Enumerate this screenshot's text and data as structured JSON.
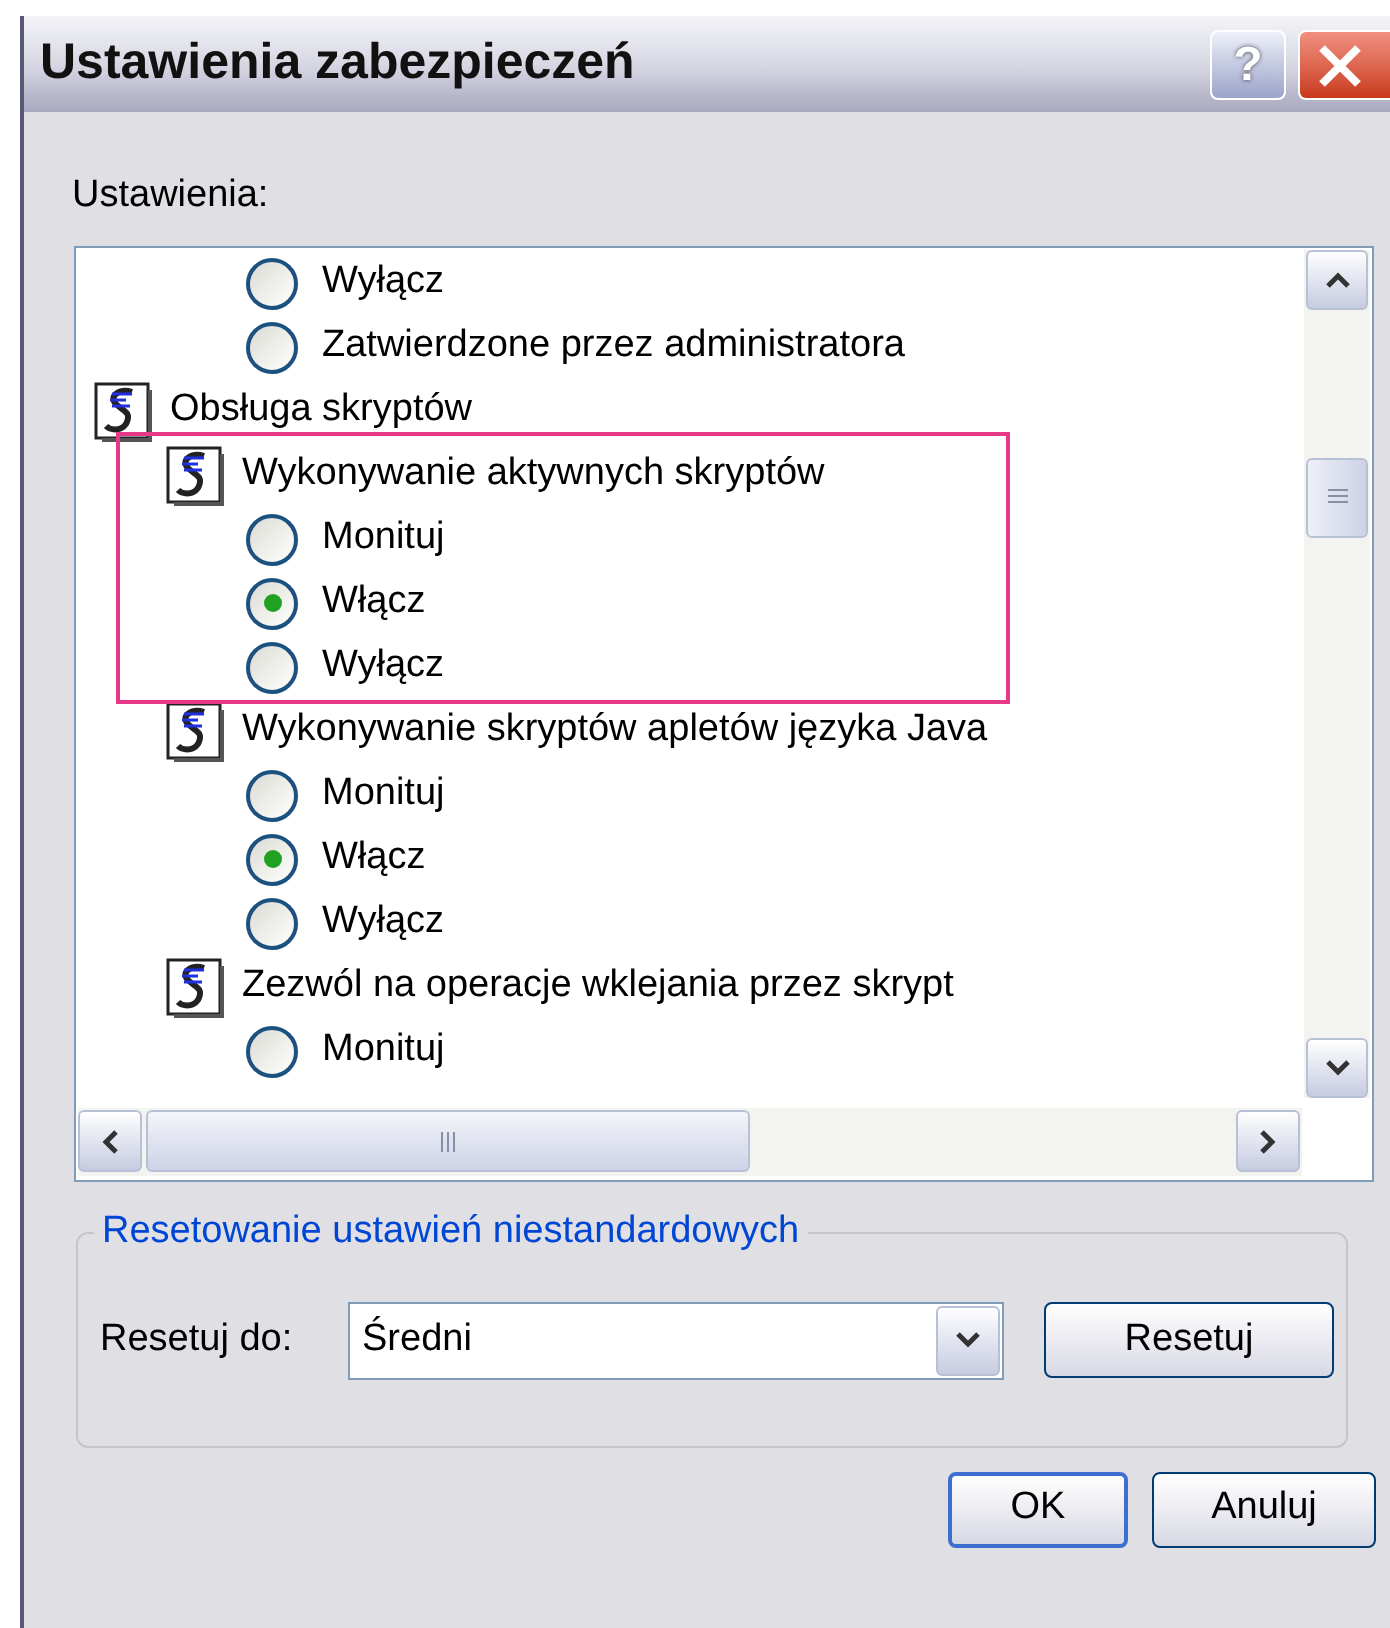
{
  "window": {
    "title": "Ustawienia zabezpieczeń",
    "help_button": "?"
  },
  "settings_label": "Ustawienia:",
  "settings_list": [
    {
      "kind": "radio",
      "label": "Wyłącz",
      "selected": false
    },
    {
      "kind": "radio",
      "label": "Zatwierdzone przez administratora",
      "selected": false
    },
    {
      "kind": "category",
      "label": "Obsługa skryptów",
      "children": [
        {
          "kind": "setting",
          "label": "Wykonywanie aktywnych skryptów",
          "highlighted": true,
          "children": [
            {
              "kind": "radio",
              "label": "Monituj",
              "selected": false
            },
            {
              "kind": "radio",
              "label": "Włącz",
              "selected": true
            },
            {
              "kind": "radio",
              "label": "Wyłącz",
              "selected": false
            }
          ]
        },
        {
          "kind": "setting",
          "label": "Wykonywanie skryptów apletów języka Java",
          "highlighted": false,
          "children": [
            {
              "kind": "radio",
              "label": "Monituj",
              "selected": false
            },
            {
              "kind": "radio",
              "label": "Włącz",
              "selected": true
            },
            {
              "kind": "radio",
              "label": "Wyłącz",
              "selected": false
            }
          ]
        },
        {
          "kind": "setting",
          "label": "Zezwól na operacje wklejania przez skrypt",
          "highlighted": false,
          "children": [
            {
              "kind": "radio",
              "label": "Monituj",
              "selected": false
            }
          ]
        }
      ]
    }
  ],
  "reset_group": {
    "title": "Resetowanie ustawień niestandardowych",
    "label": "Resetuj do:",
    "value": "Średni",
    "button": "Resetuj"
  },
  "buttons": [
    "OK",
    "Anuluj"
  ]
}
